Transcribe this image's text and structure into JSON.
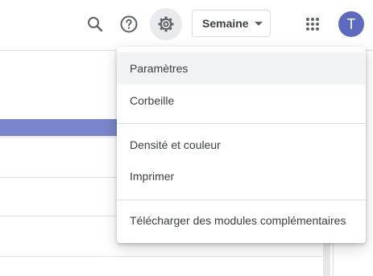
{
  "header": {
    "view_select": "Semaine",
    "avatar_initial": "T",
    "icons": {
      "search": "search-icon",
      "help": "help-icon",
      "settings": "gear-icon",
      "apps": "apps-grid-icon"
    }
  },
  "settings_menu": {
    "items": [
      {
        "label": "Paramètres"
      },
      {
        "label": "Corbeille"
      },
      {
        "label": "Densité et couleur"
      },
      {
        "label": "Imprimer"
      },
      {
        "label": "Télécharger des modules complémentaires"
      }
    ]
  },
  "colors": {
    "avatar": "#5c6bc0",
    "event_bar": "#7986cb",
    "menu_hover": "#f1f3f4"
  }
}
